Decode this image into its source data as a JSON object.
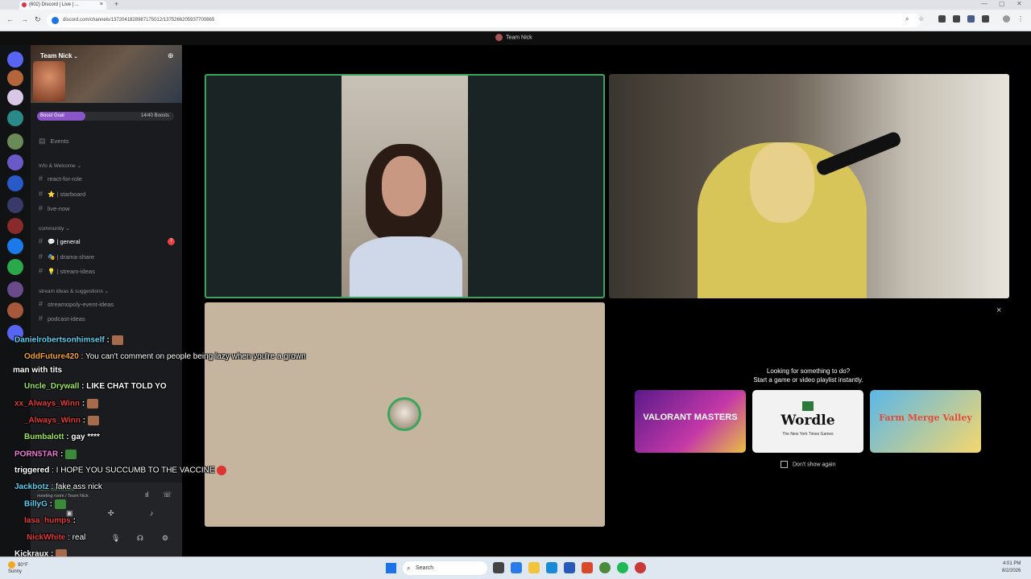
{
  "browser": {
    "tab_title": "(602) Discord | Live | ...",
    "new_tab": "+",
    "tab_close": "×",
    "url": "discord.com/channels/1372041828987175012/1375266205937700865"
  },
  "discord": {
    "window_title": "Team Nick",
    "server_name": "Team Nick",
    "boost_label": "Boost Goal",
    "boost_count": "14/40 Boosts",
    "boost_progress": 0.35,
    "events_label": "Events",
    "categories": [
      {
        "label": "Info & Welcome"
      },
      {
        "label": "community"
      },
      {
        "label": "stream ideas & suggestions"
      }
    ],
    "channels": [
      {
        "label": "react-for-role"
      },
      {
        "label": "⭐ | starboard"
      },
      {
        "label": "live-now"
      },
      {
        "label": "💬 | general"
      },
      {
        "label": "🎭 | drama-share"
      },
      {
        "label": "💡 | stream-ideas"
      },
      {
        "label": "streamopoly-event-ideas"
      },
      {
        "label": "podcast-ideas"
      }
    ],
    "general_mentions": "7",
    "voice_status": "Video Connected",
    "voice_room": "meeting room / Team Nick"
  },
  "activity": {
    "title_line1": "Looking for something to do?",
    "title_line2": "Start a game or video playlist instantly.",
    "cards": [
      {
        "name": "VALORANT MASTERS",
        "sub": ""
      },
      {
        "name": "Wordle",
        "sub": "The New York Times Games"
      },
      {
        "name": "Farm Merge Valley",
        "sub": ""
      }
    ],
    "dont_show": "Don't show again",
    "close": "×"
  },
  "chat": [
    {
      "user": "Danielrobertsonhimself",
      "text": " :",
      "color": "#5ad1f2"
    },
    {
      "user": "OddFuture420",
      "text": " : You can't comment on people being lazy when you're a grown",
      "color": "#f2a23c"
    },
    {
      "user": "",
      "text": "man with tits",
      "color": "#ffffff"
    },
    {
      "user": "Uncle_Drywall",
      "text": " : LIKE CHAT TOLD YO",
      "color": "#9be85a"
    },
    {
      "user": "xx_Always_Winn",
      "text": " :",
      "color": "#e23b3b"
    },
    {
      "user": "_Always_Winn",
      "text": " :",
      "color": "#e23b3b"
    },
    {
      "user": "Bumbalott",
      "text": " : gay ****",
      "color": "#9be85a"
    },
    {
      "user": "PORN5TAR",
      "text": " :",
      "color": "#f27bd8"
    },
    {
      "user": "triggered",
      "text": " : I HOPE YOU SUCCUMB TO THE VACCINE",
      "color": "#ffffff"
    },
    {
      "user": "Jackbotz",
      "text": " : fake ass nick",
      "color": "#5ad1f2"
    },
    {
      "user": "BillyG",
      "text": " :",
      "color": "#5ad1f2"
    },
    {
      "user": "lasa_humps",
      "text": " :",
      "color": "#e23b3b"
    },
    {
      "user": "NickWhite",
      "text": " : real",
      "color": "#e23b3b"
    },
    {
      "user": "Kickraux",
      "text": " :",
      "color": "#ffffff"
    }
  ],
  "taskbar": {
    "weather_temp": "90°F",
    "weather_desc": "Sunny",
    "search": "Search",
    "time": "4:01 PM",
    "date": "8/2/2026"
  }
}
